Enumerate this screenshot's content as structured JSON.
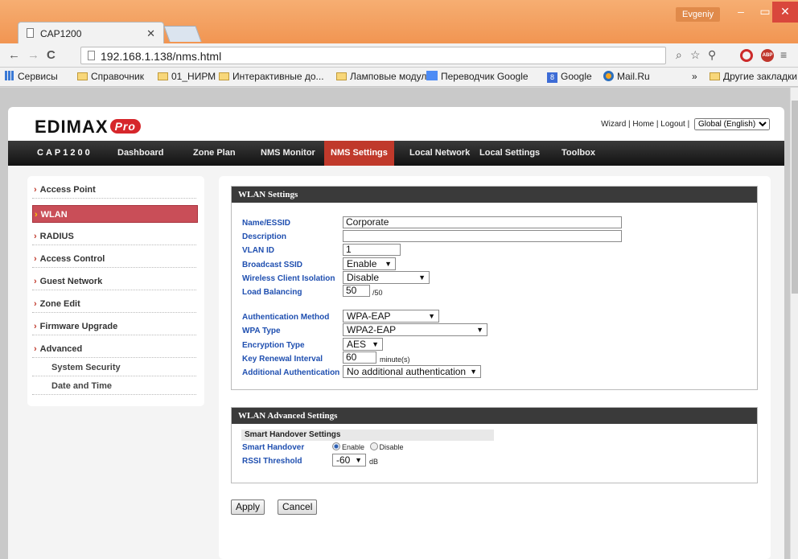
{
  "browser": {
    "tab_title": "CAP1200",
    "user": "Evgeniy",
    "url": "192.168.1.138/nms.html",
    "bookmarks": [
      "Сервисы",
      "Справочник",
      "01_НИРМ",
      "Интерактивные до...",
      "Ламповые модули",
      "Переводчик Google",
      "Google",
      "Mail.Ru",
      "»",
      "Другие закладки"
    ]
  },
  "header": {
    "logo": "EDIMAX",
    "logo_pro": "Pro",
    "links": "Wizard | Home | Logout |",
    "language": "Global (English)"
  },
  "nav": {
    "brand": "CAP1200",
    "items": [
      "Dashboard",
      "Zone Plan",
      "NMS Monitor",
      "NMS Settings",
      "Local Network",
      "Local Settings",
      "Toolbox"
    ],
    "active": "NMS Settings"
  },
  "sidebar": {
    "items": [
      "Access Point",
      "WLAN",
      "RADIUS",
      "Access Control",
      "Guest Network",
      "Zone Edit",
      "Firmware Upgrade",
      "Advanced"
    ],
    "sub_items": [
      "System Security",
      "Date and Time"
    ],
    "active": "WLAN"
  },
  "wlan": {
    "title": "WLAN Settings",
    "labels": {
      "essid": "Name/ESSID",
      "description": "Description",
      "vlan": "VLAN ID",
      "broadcast": "Broadcast SSID",
      "isolation": "Wireless Client Isolation",
      "load": "Load Balancing",
      "auth": "Authentication Method",
      "wpa": "WPA Type",
      "enc": "Encryption Type",
      "renew": "Key Renewal Interval",
      "addauth": "Additional Authentication"
    },
    "values": {
      "essid": "Corporate",
      "description": "",
      "vlan": "1",
      "broadcast": "Enable",
      "isolation": "Disable",
      "load": "50",
      "load_max": "/50",
      "auth": "WPA-EAP",
      "wpa": "WPA2-EAP",
      "enc": "AES",
      "renew": "60",
      "renew_unit": "minute(s)",
      "addauth": "No additional authentication"
    }
  },
  "adv": {
    "title": "WLAN Advanced Settings",
    "subhead": "Smart Handover Settings",
    "handover_label": "Smart Handover",
    "enable": "Enable",
    "disable": "Disable",
    "rssi_label": "RSSI Threshold",
    "rssi_value": "-60",
    "rssi_unit": "dB"
  },
  "actions": {
    "apply": "Apply",
    "cancel": "Cancel"
  }
}
